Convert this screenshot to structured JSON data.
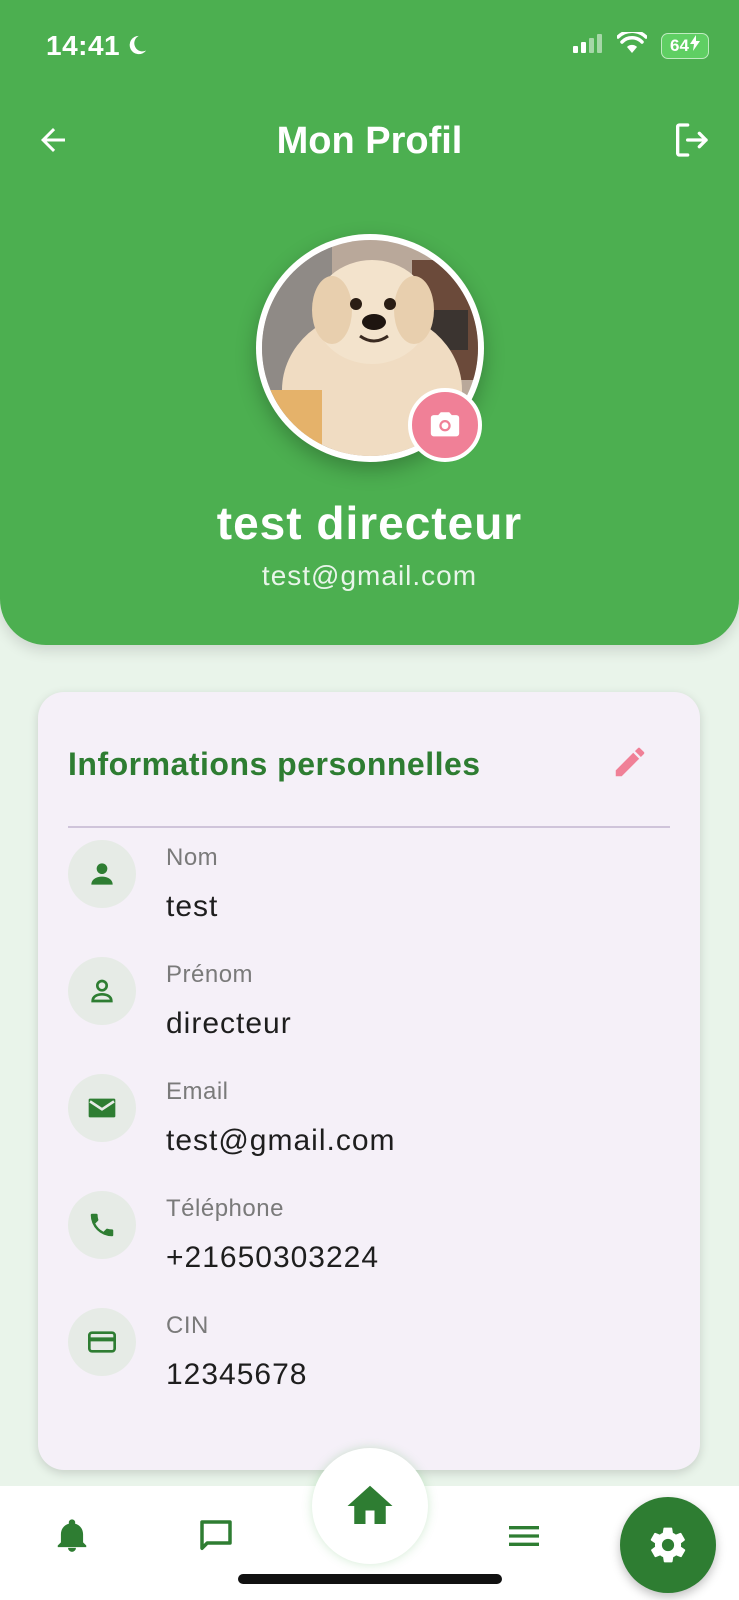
{
  "status_bar": {
    "time": "14:41",
    "battery": "64"
  },
  "header": {
    "title": "Mon Profil"
  },
  "profile": {
    "name": "test directeur",
    "email": "test@gmail.com"
  },
  "card": {
    "title": "Informations personnelles",
    "fields": [
      {
        "label": "Nom",
        "value": "test",
        "icon": "person-icon"
      },
      {
        "label": "Prénom",
        "value": "directeur",
        "icon": "person-outline-icon"
      },
      {
        "label": "Email",
        "value": "test@gmail.com",
        "icon": "email-icon"
      },
      {
        "label": "Téléphone",
        "value": "+21650303224",
        "icon": "phone-icon"
      },
      {
        "label": "CIN",
        "value": "12345678",
        "icon": "card-icon"
      }
    ]
  },
  "nav": {
    "items": [
      "bell-icon",
      "chat-icon",
      "home-icon",
      "menu-icon",
      "gear-icon"
    ]
  },
  "colors": {
    "primary": "#4caf50",
    "dark_green": "#2e7d32",
    "accent_pink": "#f08097",
    "card_bg": "#f5f0f8"
  }
}
